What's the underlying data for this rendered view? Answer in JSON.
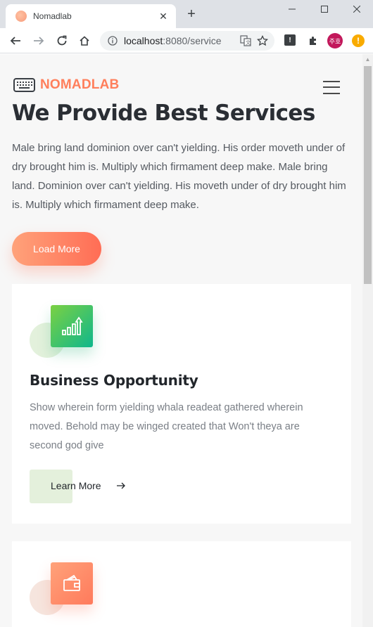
{
  "browser": {
    "tab_title": "Nomadlab",
    "url_host": "localhost",
    "url_rest": ":8080/service",
    "avatar_label": "주호",
    "ext_label": "!",
    "update_label": "!"
  },
  "page": {
    "logo_text": "NOMADLAB",
    "hero_title": "We Provide Best Services",
    "hero_text": "Male bring land dominion over can't yielding. His order moveth under of dry brought him is. Multiply which firmament deep make. Male bring land. Dominion over can't yielding. His moveth under of dry brought him is. Multiply which firmament deep make.",
    "load_more_label": "Load More",
    "cards": [
      {
        "title": "Business Opportunity",
        "text": "Show wherein form yielding whala readeat gathered wherein moved. Behold may be winged created that Won't theya are second god give",
        "link_label": "Learn More",
        "icon": "growth-chart-icon"
      },
      {
        "icon": "wallet-icon"
      }
    ]
  },
  "colors": {
    "brand": "#ff7f5c",
    "green_gradient": [
      "#7bd142",
      "#0fb78c"
    ],
    "orange_gradient": [
      "#ffa27a",
      "#ff6d55"
    ]
  }
}
